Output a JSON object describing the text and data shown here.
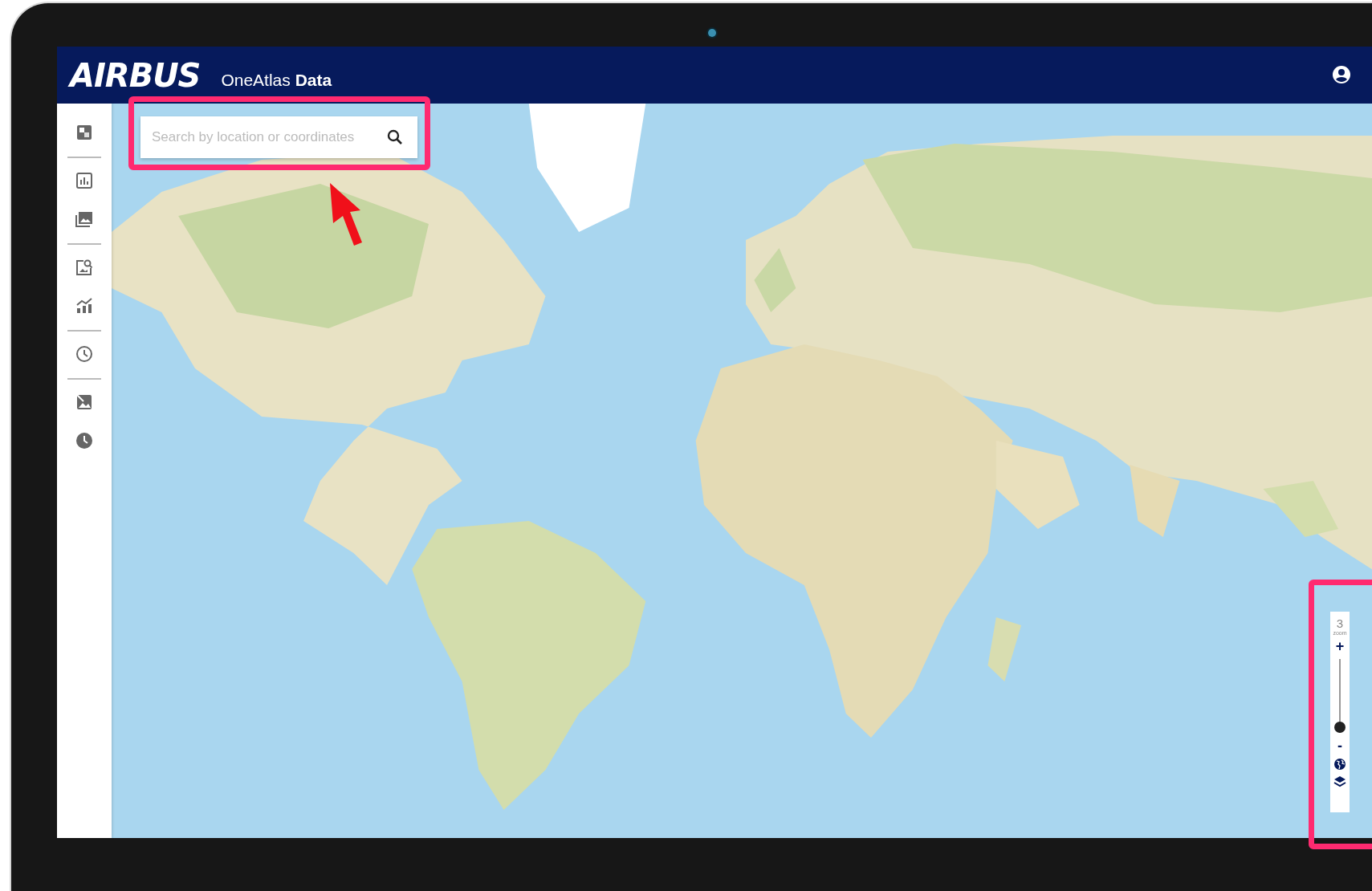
{
  "header": {
    "logo": "AIRBUS",
    "product": "OneAtlas **Data**"
  },
  "search": {
    "placeholder": "Search by location or coordinates"
  },
  "zoom_control": {
    "value": "3",
    "label": "zoom",
    "zoom_in": "+",
    "zoom_out": "-",
    "slider": {
      "level": 0.08
    }
  }
}
